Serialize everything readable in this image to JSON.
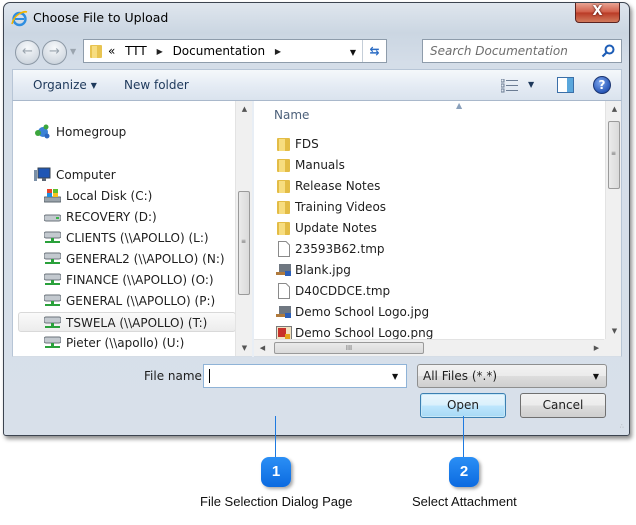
{
  "window": {
    "title": "Choose File to Upload",
    "close_label": "X"
  },
  "navigation": {
    "back_glyph": "←",
    "forward_glyph": "→",
    "breadcrumb": [
      "«",
      "TTT",
      "Documentation"
    ],
    "search_placeholder": "Search Documentation"
  },
  "toolbar": {
    "organize_label": "Organize",
    "new_folder_label": "New folder",
    "help_glyph": "?"
  },
  "sidebar": {
    "items": [
      {
        "label": "Homegroup",
        "icon": "homegroup-icon"
      },
      {
        "label": "Computer",
        "icon": "computer-icon"
      },
      {
        "label": "Local Disk (C:)",
        "icon": "system-drive-icon"
      },
      {
        "label": "RECOVERY (D:)",
        "icon": "drive-icon"
      },
      {
        "label": "CLIENTS (\\\\APOLLO) (L:)",
        "icon": "network-drive-icon"
      },
      {
        "label": "GENERAL2 (\\\\APOLLO) (N:)",
        "icon": "network-drive-icon"
      },
      {
        "label": "FINANCE (\\\\APOLLO) (O:)",
        "icon": "network-drive-icon"
      },
      {
        "label": "GENERAL (\\\\APOLLO) (P:)",
        "icon": "network-drive-icon"
      },
      {
        "label": "TSWELA (\\\\APOLLO) (T:)",
        "icon": "network-drive-icon",
        "selected": true
      },
      {
        "label": "Pieter (\\\\apollo) (U:)",
        "icon": "network-drive-icon"
      }
    ]
  },
  "file_list": {
    "column_header": "Name",
    "items": [
      {
        "name": "FDS",
        "type": "folder"
      },
      {
        "name": "Manuals",
        "type": "folder"
      },
      {
        "name": "Release Notes",
        "type": "folder"
      },
      {
        "name": "Training Videos",
        "type": "folder"
      },
      {
        "name": "Update Notes",
        "type": "folder"
      },
      {
        "name": "23593B62.tmp",
        "type": "file"
      },
      {
        "name": "Blank.jpg",
        "type": "image"
      },
      {
        "name": "D40CDDCE.tmp",
        "type": "file"
      },
      {
        "name": "Demo School Logo.jpg",
        "type": "image"
      },
      {
        "name": "Demo School Logo.png",
        "type": "png"
      }
    ]
  },
  "footer": {
    "filename_label": "File name:",
    "filename_value": "",
    "filetype_value": "All Files (*.*)",
    "open_label": "Open",
    "cancel_label": "Cancel"
  },
  "callouts": [
    {
      "number": "1",
      "label": "File Selection Dialog Page"
    },
    {
      "number": "2",
      "label": "Select Attachment"
    }
  ],
  "colors": {
    "callout_blue": "#1e7ae0",
    "close_red": "#c7452f",
    "open_button_border": "#3c7fb1"
  }
}
